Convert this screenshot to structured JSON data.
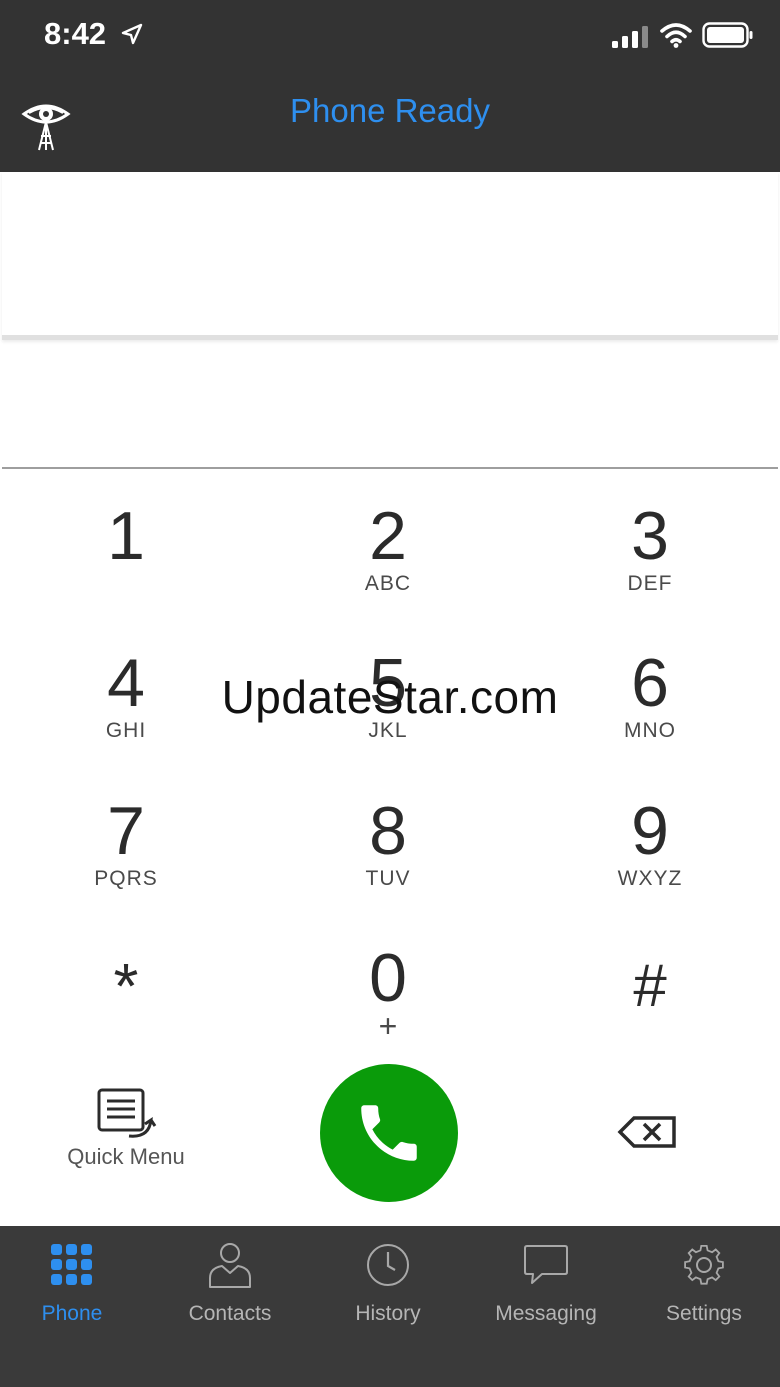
{
  "status_bar": {
    "time": "8:42"
  },
  "header": {
    "title": "Phone Ready"
  },
  "dialpad": {
    "keys": [
      {
        "digit": "1",
        "letters": ""
      },
      {
        "digit": "2",
        "letters": "ABC"
      },
      {
        "digit": "3",
        "letters": "DEF"
      },
      {
        "digit": "4",
        "letters": "GHI"
      },
      {
        "digit": "5",
        "letters": "JKL"
      },
      {
        "digit": "6",
        "letters": "MNO"
      },
      {
        "digit": "7",
        "letters": "PQRS"
      },
      {
        "digit": "8",
        "letters": "TUV"
      },
      {
        "digit": "9",
        "letters": "WXYZ"
      },
      {
        "digit": "*",
        "letters": ""
      },
      {
        "digit": "0",
        "letters": "+"
      },
      {
        "digit": "#",
        "letters": ""
      }
    ]
  },
  "actions": {
    "quick_menu_label": "Quick Menu"
  },
  "watermark": "UpdateStar.com",
  "tabs": [
    {
      "label": "Phone",
      "icon": "dialpad-grid-icon",
      "active": true
    },
    {
      "label": "Contacts",
      "icon": "person-icon",
      "active": false
    },
    {
      "label": "History",
      "icon": "clock-icon",
      "active": false
    },
    {
      "label": "Messaging",
      "icon": "chat-bubble-icon",
      "active": false
    },
    {
      "label": "Settings",
      "icon": "gear-icon",
      "active": false
    }
  ],
  "colors": {
    "header_bg": "#333333",
    "accent_blue": "#2e8fef",
    "call_green": "#0a9b0a",
    "tabbar_bg": "#3a3a3a"
  }
}
